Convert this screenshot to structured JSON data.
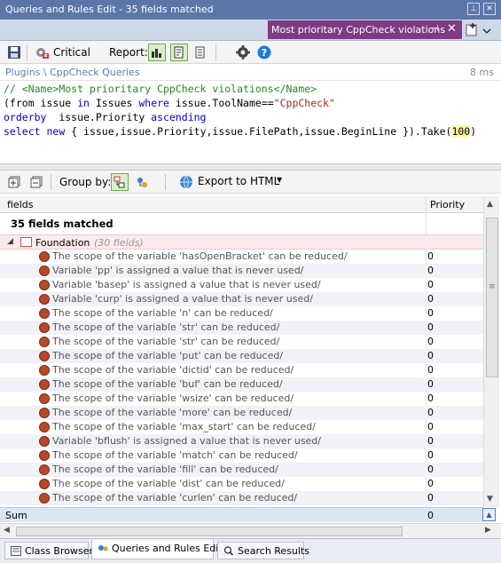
{
  "window": {
    "title": "Queries and Rules Edit  -  35 fields matched",
    "pin_glyph": "⊥",
    "close_glyph": "✕"
  },
  "tab": {
    "label": "Most prioritary CppCheck violations",
    "pin_glyph": "⊣",
    "close_glyph": "✕"
  },
  "toolbar": {
    "critical_label": "Critical",
    "report_label": "Report:"
  },
  "breadcrumb": "Plugins \\ CppCheck Queries",
  "elapsed": "8 ms",
  "query": {
    "line1_open": "// <Name>",
    "line1_name": "Most prioritary CppCheck violations",
    "line1_close": "</Name>",
    "line2_a": "(from",
    "line2_b": " issue ",
    "line2_c": "in",
    "line2_d": " Issues ",
    "line2_e": "where",
    "line2_f": " issue.ToolName==",
    "line2_g": "\"CppCheck\"",
    "line3_a": "orderby",
    "line3_b": "  issue.Priority ",
    "line3_c": "ascending",
    "line4_a": "select",
    "line4_b": " ",
    "line4_c": "new",
    "line4_d": " { issue,issue.Priority,issue.FilePath,issue.BeginLine }).Take(",
    "line4_e": "100",
    "line4_f": ")"
  },
  "results_toolbar": {
    "group_by_label": "Group by:",
    "export_label": "Export to HTML"
  },
  "grid": {
    "col_fields": "fields",
    "col_priority": "Priority",
    "matched_label": "35 fields matched",
    "group_name": "Foundation",
    "group_count": "(30 fields)",
    "rows": [
      {
        "text": "The scope of the variable 'hasOpenBracket' can be reduced/",
        "value": "0"
      },
      {
        "text": "Variable 'pp' is assigned a value that is never used/",
        "value": "0"
      },
      {
        "text": "Variable 'basep' is assigned a value that is never used/",
        "value": "0"
      },
      {
        "text": "Variable 'curp' is assigned a value that is never used/",
        "value": "0"
      },
      {
        "text": "The scope of the variable 'n' can be reduced/",
        "value": "0"
      },
      {
        "text": "The scope of the variable 'str' can be reduced/",
        "value": "0"
      },
      {
        "text": "The scope of the variable 'str' can be reduced/",
        "value": "0"
      },
      {
        "text": "The scope of the variable 'put' can be reduced/",
        "value": "0"
      },
      {
        "text": "The scope of the variable 'dictid' can be reduced/",
        "value": "0"
      },
      {
        "text": "The scope of the variable 'buf' can be reduced/",
        "value": "0"
      },
      {
        "text": "The scope of the variable 'wsize' can be reduced/",
        "value": "0"
      },
      {
        "text": "The scope of the variable 'more' can be reduced/",
        "value": "0"
      },
      {
        "text": "The scope of the variable 'max_start' can be reduced/",
        "value": "0"
      },
      {
        "text": "Variable 'bflush' is assigned a value that is never used/",
        "value": "0"
      },
      {
        "text": "The scope of the variable 'match' can be reduced/",
        "value": "0"
      },
      {
        "text": "The scope of the variable 'fill' can be reduced/",
        "value": "0"
      },
      {
        "text": "The scope of the variable 'dist' can be reduced/",
        "value": "0"
      },
      {
        "text": "The scope of the variable 'curlen' can be reduced/",
        "value": "0"
      }
    ],
    "sum_label": "Sum",
    "sum_value": "0"
  },
  "bottom_tabs": [
    {
      "label": "Class Browser"
    },
    {
      "label": "Queries and Rules Edit"
    },
    {
      "label": "Search Results"
    }
  ],
  "colors": {
    "titlebar": "#5b77a8",
    "active_tab": "#7e3b85",
    "group_row": "#fdeaea",
    "sum_row": "#dbe6f5"
  }
}
